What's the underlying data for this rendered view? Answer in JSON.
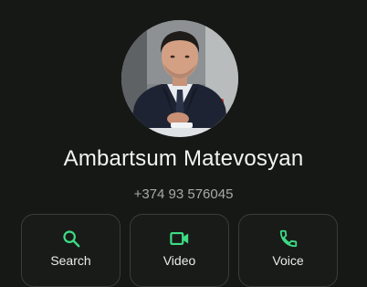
{
  "contact": {
    "name": "Ambartsum Matevosyan",
    "phone": "+374 93 576045"
  },
  "actions": [
    {
      "label": "Search",
      "icon": "search-icon"
    },
    {
      "label": "Video",
      "icon": "video-camera-icon"
    },
    {
      "label": "Voice",
      "icon": "phone-icon"
    }
  ],
  "colors": {
    "background": "#161816",
    "accent": "#3ddc84",
    "text_primary": "#f2f4f2",
    "text_secondary": "#a7aaa7",
    "button_border": "#3a3d3a"
  }
}
